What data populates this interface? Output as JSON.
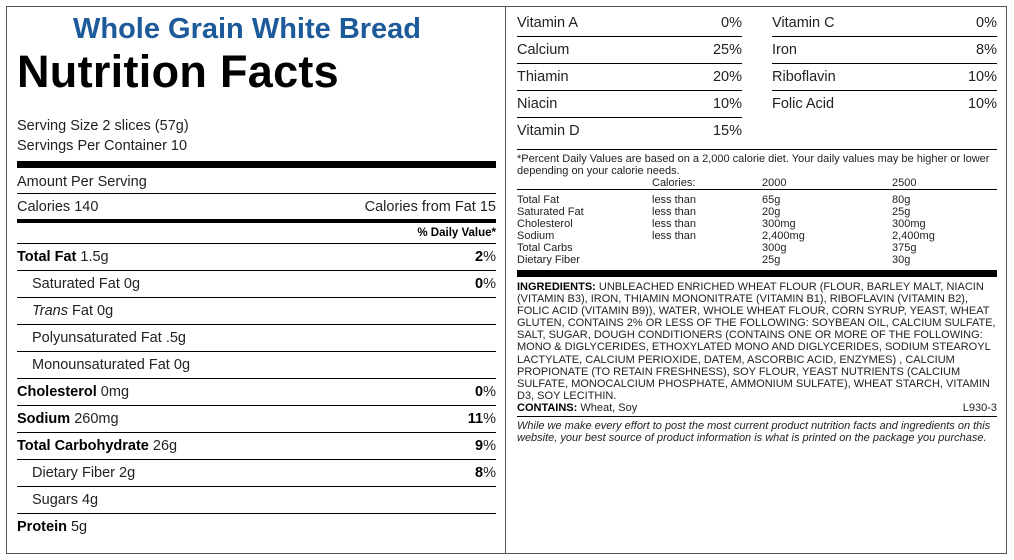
{
  "product_name": "Whole Grain White Bread",
  "panel_title": "Nutrition Facts",
  "serving_size": "Serving Size 2 slices (57g)",
  "servings_per_container": "Servings Per Container 10",
  "amount_per_serving": "Amount Per Serving",
  "calories": "Calories 140",
  "calories_from_fat": "Calories from Fat 15",
  "daily_value_header": "% Daily Value*",
  "nutrients": [
    {
      "name": "Total Fat",
      "amount": "1.5g",
      "dv": "2",
      "bold": true,
      "indent": false
    },
    {
      "name": "Saturated Fat",
      "amount": "0g",
      "dv": "0",
      "bold": false,
      "indent": true
    },
    {
      "name": "Trans",
      "amount": "Fat 0g",
      "dv": "",
      "bold": false,
      "indent": true,
      "italic_name": true
    },
    {
      "name": "Polyunsaturated Fat",
      "amount": ".5g",
      "dv": "",
      "bold": false,
      "indent": true
    },
    {
      "name": "Monounsaturated Fat",
      "amount": "0g",
      "dv": "",
      "bold": false,
      "indent": true
    },
    {
      "name": "Cholesterol",
      "amount": "0mg",
      "dv": "0",
      "bold": true,
      "indent": false
    },
    {
      "name": "Sodium",
      "amount": "260mg",
      "dv": "11",
      "bold": true,
      "indent": false
    },
    {
      "name": "Total Carbohydrate",
      "amount": "26g",
      "dv": "9",
      "bold": true,
      "indent": false
    },
    {
      "name": "Dietary Fiber",
      "amount": "2g",
      "dv": "8",
      "bold": false,
      "indent": true
    },
    {
      "name": "Sugars",
      "amount": "4g",
      "dv": "",
      "bold": false,
      "indent": true
    },
    {
      "name": "Protein",
      "amount": "5g",
      "dv": "",
      "bold": true,
      "indent": false
    }
  ],
  "percent_sign": "%",
  "vitamins_left": [
    {
      "name": "Vitamin A",
      "value": "0%"
    },
    {
      "name": "Calcium",
      "value": "25%"
    },
    {
      "name": "Thiamin",
      "value": "20%"
    },
    {
      "name": "Niacin",
      "value": "10%"
    },
    {
      "name": "Vitamin D",
      "value": "15%"
    }
  ],
  "vitamins_right": [
    {
      "name": "Vitamin C",
      "value": "0%"
    },
    {
      "name": "Iron",
      "value": "8%"
    },
    {
      "name": "Riboflavin",
      "value": "10%"
    },
    {
      "name": "Folic Acid",
      "value": "10%"
    }
  ],
  "footnote": "*Percent Daily Values are based on a 2,000 calorie diet. Your daily values may be higher or lower depending on your calorie needs.",
  "dv_table": {
    "header": [
      "",
      "Calories:",
      "2000",
      "2500"
    ],
    "rows": [
      [
        "Total Fat",
        "less than",
        "65g",
        "80g"
      ],
      [
        "Saturated Fat",
        "less than",
        "20g",
        "25g"
      ],
      [
        "Cholesterol",
        "less than",
        "300mg",
        "300mg"
      ],
      [
        "Sodium",
        "less than",
        "2,400mg",
        "2,400mg"
      ],
      [
        "Total Carbs",
        "",
        "300g",
        "375g"
      ],
      [
        "Dietary Fiber",
        "",
        "25g",
        "30g"
      ]
    ]
  },
  "ingredients_label": "INGREDIENTS:",
  "ingredients_text": " UNBLEACHED ENRICHED WHEAT FLOUR (FLOUR, BARLEY MALT, NIACIN (VITAMIN B3), IRON, THIAMIN MONONITRATE (VITAMIN B1), RIBOFLAVIN (VITAMIN B2), FOLIC ACID (VITAMIN B9)), WATER, WHOLE WHEAT FLOUR, CORN SYRUP, YEAST, WHEAT GLUTEN, CONTAINS 2% OR LESS OF THE FOLLOWING: SOYBEAN OIL, CALCIUM SULFATE, SALT, SUGAR, DOUGH CONDITIONERS (CONTAINS ONE OR MORE OF THE FOLLOWING: MONO & DIGLYCERIDES, ETHOXYLATED MONO AND DIGLYCERIDES, SODIUM STEAROYL LACTYLATE, CALCIUM PERIOXIDE, DATEM, ASCORBIC ACID, ENZYMES) , CALCIUM PROPIONATE (TO RETAIN FRESHNESS), SOY FLOUR, YEAST NUTRIENTS (CALCIUM SULFATE, MONOCALCIUM PHOSPHATE, AMMONIUM SULFATE), WHEAT STARCH, VITAMIN D3, SOY LECITHIN.",
  "contains_label": "CONTAINS:",
  "contains_text": " Wheat, Soy",
  "code": "L930-3",
  "disclaimer": "While we make every effort to post the most current product nutrition facts and ingredients on this website, your best source of product information is what is printed on the package you purchase."
}
